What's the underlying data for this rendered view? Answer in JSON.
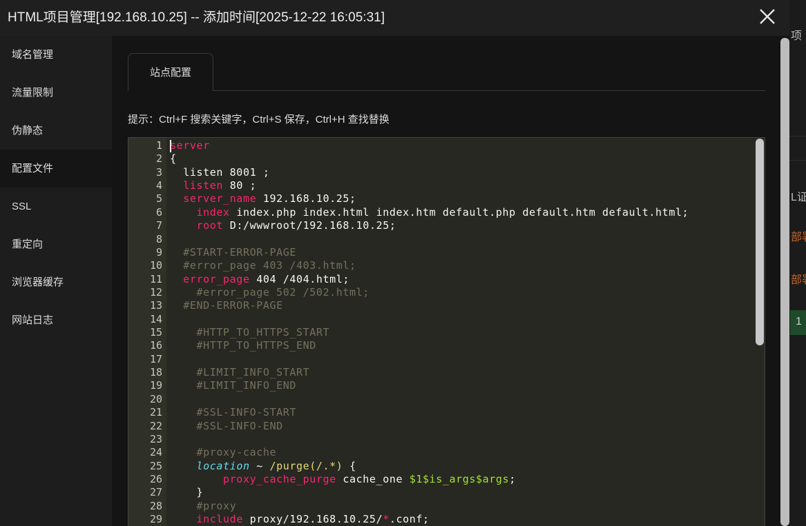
{
  "title": "HTML项目管理[192.168.10.25] -- 添加时间[2025-12-22 16:05:31]",
  "sidebar": {
    "items": [
      {
        "label": "域名管理"
      },
      {
        "label": "流量限制"
      },
      {
        "label": "伪静态"
      },
      {
        "label": "配置文件",
        "active": true
      },
      {
        "label": "SSL"
      },
      {
        "label": "重定向"
      },
      {
        "label": "浏览器缓存"
      },
      {
        "label": "网站日志"
      }
    ]
  },
  "tabs": [
    {
      "label": "站点配置",
      "active": true
    }
  ],
  "hint": "提示：Ctrl+F 搜索关键字，Ctrl+S 保存，Ctrl+H 查找替换",
  "colors": {
    "keyword": "#f92672",
    "comment": "#75715e",
    "builtin": "#66d9ef",
    "string": "#e6db74",
    "variable": "#a6e22e",
    "editor_bg": "#272822"
  },
  "background_fragments": [
    {
      "text": "项"
    },
    {
      "text": "L证"
    },
    {
      "text": "部署",
      "color": "#c5622b"
    },
    {
      "text": "部署",
      "color": "#c5622b"
    },
    {
      "text": "1",
      "color": "#1f4a2b"
    }
  ],
  "editor": {
    "lines": [
      [
        [
          "server",
          "kw"
        ]
      ],
      [
        [
          "{",
          ""
        ]
      ],
      [
        [
          "  listen 8001 ;",
          ""
        ]
      ],
      [
        [
          "  ",
          ""
        ],
        [
          "listen",
          "kw"
        ],
        [
          " 80 ;",
          ""
        ]
      ],
      [
        [
          "  ",
          ""
        ],
        [
          "server_name",
          "kw"
        ],
        [
          " 192.168.10.25;",
          ""
        ]
      ],
      [
        [
          "    ",
          ""
        ],
        [
          "index",
          "kw"
        ],
        [
          " index.php index.html index.htm default.php default.htm default.html;",
          ""
        ]
      ],
      [
        [
          "    ",
          ""
        ],
        [
          "root",
          "kw"
        ],
        [
          " D:/wwwroot/192.168.10.25;",
          ""
        ]
      ],
      [],
      [
        [
          "  #START-ERROR-PAGE",
          "cm"
        ]
      ],
      [
        [
          "  #error_page 403 /403.html;",
          "cm"
        ]
      ],
      [
        [
          "  ",
          ""
        ],
        [
          "error_page",
          "kw"
        ],
        [
          " 404 /404.html;",
          ""
        ]
      ],
      [
        [
          "    #error_page 502 /502.html;",
          "cm"
        ]
      ],
      [
        [
          "  #END-ERROR-PAGE",
          "cm"
        ]
      ],
      [],
      [
        [
          "    #HTTP_TO_HTTPS_START",
          "cm"
        ]
      ],
      [
        [
          "    #HTTP_TO_HTTPS_END",
          "cm"
        ]
      ],
      [],
      [
        [
          "    #LIMIT_INFO_START",
          "cm"
        ]
      ],
      [
        [
          "    #LIMIT_INFO_END",
          "cm"
        ]
      ],
      [],
      [
        [
          "    #SSL-INFO-START",
          "cm"
        ]
      ],
      [
        [
          "    #SSL-INFO-END",
          "cm"
        ]
      ],
      [],
      [
        [
          "    #proxy-cache",
          "cm"
        ]
      ],
      [
        [
          "    ",
          ""
        ],
        [
          "location",
          "fn"
        ],
        [
          " ~ ",
          ""
        ],
        [
          "/purge(/.*)",
          "st"
        ],
        [
          " {",
          ""
        ]
      ],
      [
        [
          "        ",
          ""
        ],
        [
          "proxy_cache_purge",
          "kw"
        ],
        [
          " cache_one ",
          ""
        ],
        [
          "$1$is_args$args",
          "va"
        ],
        [
          ";",
          ""
        ]
      ],
      [
        [
          "    }",
          ""
        ]
      ],
      [
        [
          "    #proxy",
          "cm"
        ]
      ],
      [
        [
          "    ",
          ""
        ],
        [
          "include",
          "kw"
        ],
        [
          " proxy/192.168.10.25/",
          ""
        ],
        [
          "*",
          "kw"
        ],
        [
          ".conf;",
          ""
        ]
      ]
    ]
  }
}
